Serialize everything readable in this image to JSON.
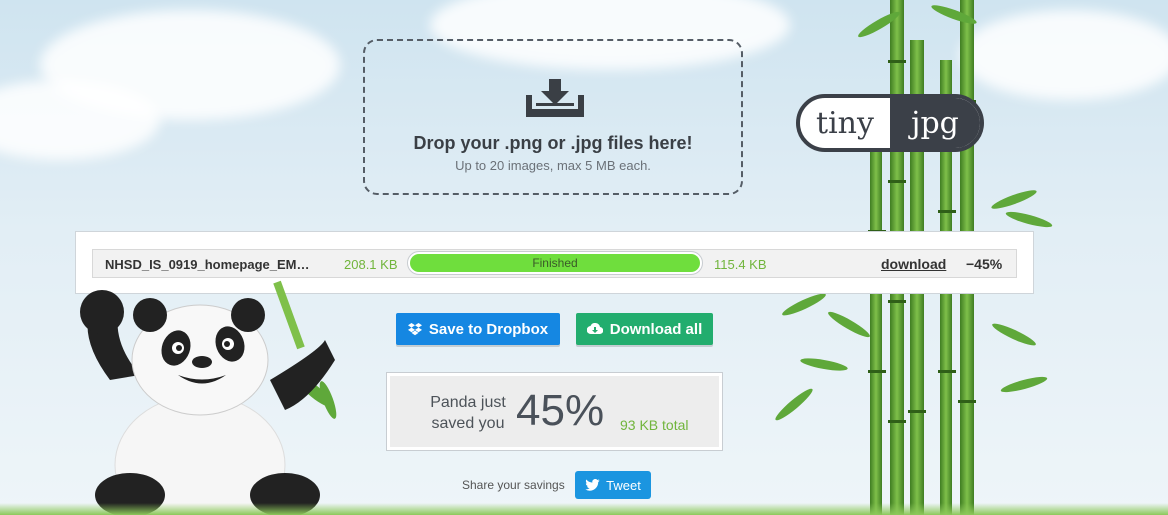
{
  "dropzone": {
    "title": "Drop your .png or .jpg files here!",
    "subtitle": "Up to 20 images, max 5 MB each.",
    "icon": "download-tray-icon"
  },
  "logo": {
    "part1": "tiny",
    "part2": "jpg"
  },
  "files": [
    {
      "name": "NHSD_IS_0919_homepage_EM…",
      "original_size": "208.1 KB",
      "status": "Finished",
      "progress": 1.0,
      "new_size": "115.4 KB",
      "download_label": "download",
      "savings_pct": "−45%"
    }
  ],
  "actions": {
    "dropbox_label": "Save to Dropbox",
    "download_all_label": "Download all"
  },
  "savings": {
    "label": "Panda just saved you",
    "percent": "45%",
    "total": "93 KB total"
  },
  "share": {
    "label": "Share your savings",
    "tweet_label": "Tweet"
  },
  "colors": {
    "accent_green": "#71b53c",
    "progress_fill": "#6fde3d",
    "dropbox_blue": "#1587e2",
    "download_green": "#22ad6e",
    "twitter_blue": "#1b95e0"
  }
}
